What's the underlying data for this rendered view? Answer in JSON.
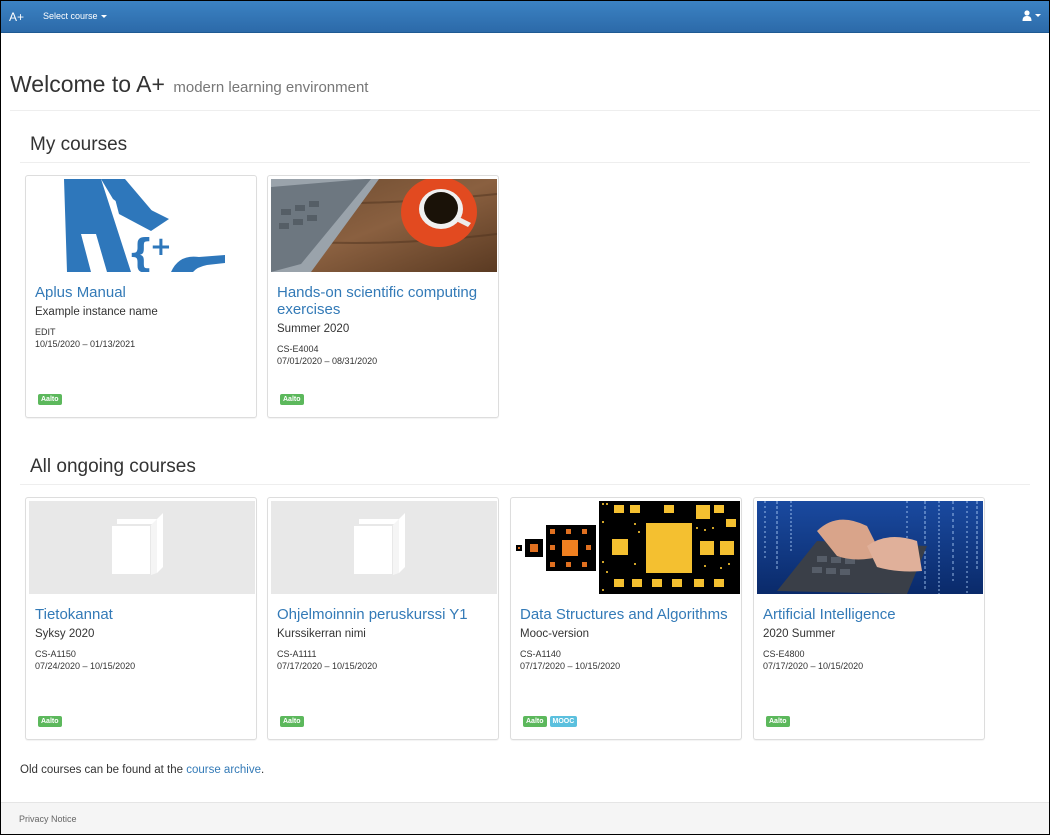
{
  "navbar": {
    "brand": "A+",
    "select_course": "Select course",
    "user_icon": "user-icon",
    "bg_color": "#337ab7"
  },
  "header": {
    "title": "Welcome to A+",
    "subtitle": "modern learning environment"
  },
  "my_courses": {
    "title": "My courses",
    "courses": [
      {
        "name": "Aplus Manual",
        "instance": "Example instance name",
        "code": "EDIT",
        "dates": "10/15/2020 – 01/13/2021",
        "badges": [
          "Aalto"
        ],
        "image": "aplus-logo"
      },
      {
        "name": "Hands-on scientific computing exercises",
        "instance": "Summer 2020",
        "code": "CS-E4004",
        "dates": "07/01/2020 – 08/31/2020",
        "badges": [
          "Aalto"
        ],
        "image": "laptop-coffee-photo"
      }
    ]
  },
  "ongoing_courses": {
    "title": "All ongoing courses",
    "courses": [
      {
        "name": "Tietokannat",
        "instance": "Syksy 2020",
        "code": "CS-A1150",
        "dates": "07/24/2020 – 10/15/2020",
        "badges": [
          "Aalto"
        ],
        "image": "book-placeholder-icon"
      },
      {
        "name": "Ohjelmoinnin peruskurssi Y1",
        "instance": "Kurssikerran nimi",
        "code": "CS-A1111",
        "dates": "07/17/2020 – 10/15/2020",
        "badges": [
          "Aalto"
        ],
        "image": "book-placeholder-icon"
      },
      {
        "name": "Data Structures and Algorithms",
        "instance": "Mooc-version",
        "code": "CS-A1140",
        "dates": "07/17/2020 – 10/15/2020",
        "badges": [
          "Aalto",
          "MOOC"
        ],
        "image": "fractal-pattern"
      },
      {
        "name": "Artificial Intelligence",
        "instance": "2020 Summer",
        "code": "CS-E4800",
        "dates": "07/17/2020 – 10/15/2020",
        "badges": [
          "Aalto"
        ],
        "image": "keyboard-code-photo"
      }
    ]
  },
  "archive": {
    "prefix": "Old courses can be found at the ",
    "link": "course archive",
    "suffix": "."
  },
  "footer": {
    "privacy": "Privacy Notice"
  }
}
